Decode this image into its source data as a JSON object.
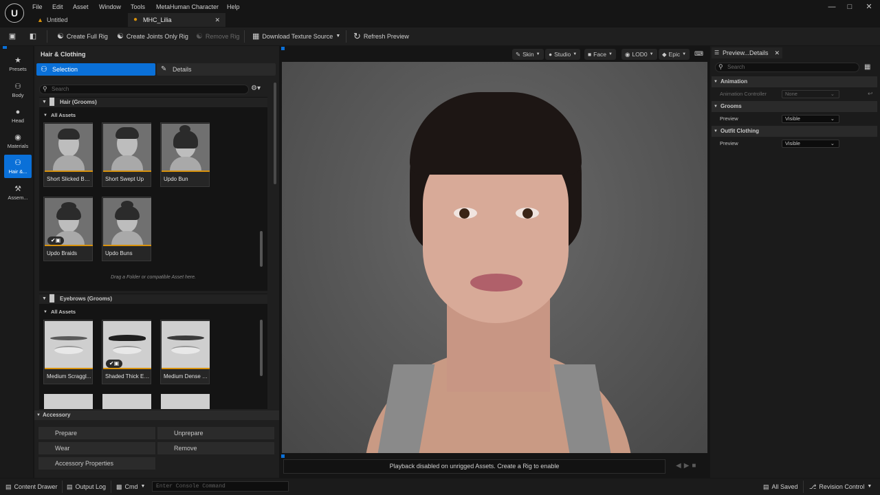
{
  "menubar": {
    "items": [
      "File",
      "Edit",
      "Asset",
      "Window",
      "Tools",
      "MetaHuman Character",
      "Help"
    ],
    "logo": "unreal-engine-logo"
  },
  "tabs": [
    {
      "label": "Untitled",
      "active": false
    },
    {
      "label": "MHC_Lilia",
      "active": true
    }
  ],
  "toolbar": {
    "create_full_rig": "Create Full Rig",
    "create_joints_only_rig": "Create Joints Only Rig",
    "remove_rig": "Remove Rig",
    "download_texture_source": "Download Texture Source",
    "refresh_preview": "Refresh Preview"
  },
  "left_nav": [
    {
      "label": "Presets",
      "icon": "star-icon",
      "active": false
    },
    {
      "label": "Body",
      "icon": "body-icon",
      "active": false
    },
    {
      "label": "Head",
      "icon": "head-icon",
      "active": false
    },
    {
      "label": "Materials",
      "icon": "materials-icon",
      "active": false
    },
    {
      "label": "Hair &...",
      "icon": "hair-icon",
      "active": true
    },
    {
      "label": "Assem...",
      "icon": "hammer-icon",
      "active": false
    }
  ],
  "panel": {
    "title": "Hair & Clothing",
    "tab_selection": "Selection",
    "tab_details": "Details",
    "search_placeholder": "Search",
    "hair_section": "Hair (Grooms)",
    "all_assets": "All Assets",
    "hair_items": [
      "Short Slicked Back",
      "Short Swept Up",
      "Updo Bun",
      "Updo Braids",
      "Updo Buns"
    ],
    "drag_hint": "Drag a Folder or compatible Asset here.",
    "eyebrows_section": "Eyebrows (Grooms)",
    "eyebrow_items": [
      "Medium Scraggl...",
      "Shaded Thick Ey...",
      "Medium Dense E..."
    ],
    "accessory_title": "Accessory",
    "accessory_buttons": [
      "Prepare",
      "Unprepare",
      "Wear",
      "Remove",
      "Accessory Properties"
    ]
  },
  "viewport": {
    "buttons": [
      "Skin",
      "Studio",
      "Face",
      "LOD0",
      "Epic"
    ],
    "playback_message": "Playback disabled on unrigged Assets. Create a Rig to enable",
    "background_color": "#5a5a5a"
  },
  "details": {
    "tab_label": "Preview...Details",
    "search_placeholder": "Search",
    "categories": [
      {
        "name": "Animation",
        "rows": [
          {
            "label": "Animation Controller",
            "value": "None",
            "disabled": true
          }
        ]
      },
      {
        "name": "Grooms",
        "rows": [
          {
            "label": "Preview",
            "value": "Visible",
            "disabled": false
          }
        ]
      },
      {
        "name": "Outfit Clothing",
        "rows": [
          {
            "label": "Preview",
            "value": "Visible",
            "disabled": false
          }
        ]
      }
    ]
  },
  "statusbar": {
    "content_drawer": "Content Drawer",
    "output_log": "Output Log",
    "cmd": "Cmd",
    "console_placeholder": "Enter Console Command",
    "all_saved": "All Saved",
    "revision_control": "Revision Control"
  },
  "colors": {
    "accent": "#0a70d8",
    "asset_underline": "#d8920c"
  }
}
